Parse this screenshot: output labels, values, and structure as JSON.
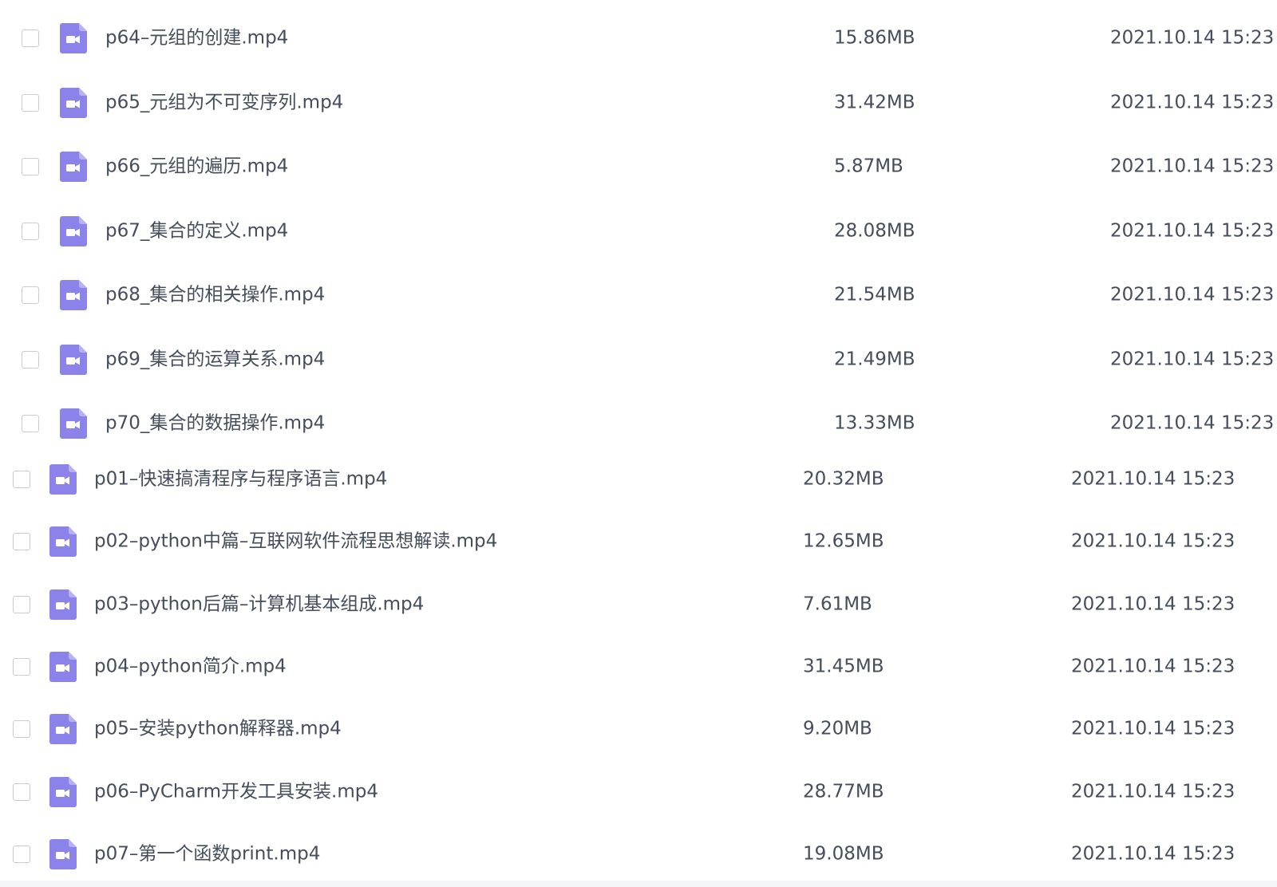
{
  "colors": {
    "icon_body": "#8b83ea",
    "icon_fold": "#b7b1f4",
    "text": "#454d5c",
    "checkbox_border": "#c9ccd2"
  },
  "icon_name": "video-file-icon",
  "section_a": [
    {
      "name": "p64–元组的创建.mp4",
      "size": "15.86MB",
      "date": "2021.10.14 15:23"
    },
    {
      "name": "p65_元组为不可变序列.mp4",
      "size": "31.42MB",
      "date": "2021.10.14 15:23"
    },
    {
      "name": "p66_元组的遍历.mp4",
      "size": "5.87MB",
      "date": "2021.10.14 15:23"
    },
    {
      "name": "p67_集合的定义.mp4",
      "size": "28.08MB",
      "date": "2021.10.14 15:23"
    },
    {
      "name": "p68_集合的相关操作.mp4",
      "size": "21.54MB",
      "date": "2021.10.14 15:23"
    },
    {
      "name": "p69_集合的运算关系.mp4",
      "size": "21.49MB",
      "date": "2021.10.14 15:23"
    },
    {
      "name": "p70_集合的数据操作.mp4",
      "size": "13.33MB",
      "date": "2021.10.14 15:23"
    }
  ],
  "section_b": [
    {
      "name": "p01–快速搞清程序与程序语言.mp4",
      "size": "20.32MB",
      "date": "2021.10.14 15:23"
    },
    {
      "name": "p02–python中篇–互联网软件流程思想解读.mp4",
      "size": "12.65MB",
      "date": "2021.10.14 15:23"
    },
    {
      "name": "p03–python后篇–计算机基本组成.mp4",
      "size": "7.61MB",
      "date": "2021.10.14 15:23"
    },
    {
      "name": "p04–python简介.mp4",
      "size": "31.45MB",
      "date": "2021.10.14 15:23"
    },
    {
      "name": "p05–安装python解释器.mp4",
      "size": "9.20MB",
      "date": "2021.10.14 15:23"
    },
    {
      "name": "p06–PyCharm开发工具安装.mp4",
      "size": "28.77MB",
      "date": "2021.10.14 15:23"
    },
    {
      "name": "p07–第一个函数print.mp4",
      "size": "19.08MB",
      "date": "2021.10.14 15:23"
    }
  ]
}
